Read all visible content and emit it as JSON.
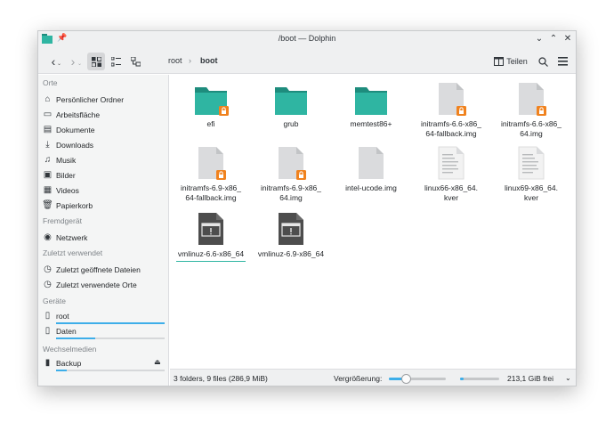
{
  "window": {
    "title": "/boot — Dolphin"
  },
  "toolbar": {
    "breadcrumb": [
      "root",
      "boot"
    ],
    "split_label": "Teilen",
    "icons": [
      "back-icon",
      "forward-icon",
      "icons-view-icon",
      "details-view-icon",
      "tree-view-icon",
      "split-icon",
      "search-icon",
      "menu-icon"
    ]
  },
  "sidebar": {
    "sections": [
      {
        "title": "Orte",
        "items": [
          {
            "label": "Persönlicher Ordner",
            "icon": "home-icon"
          },
          {
            "label": "Arbeitsfläche",
            "icon": "desktop-icon"
          },
          {
            "label": "Dokumente",
            "icon": "documents-icon"
          },
          {
            "label": "Downloads",
            "icon": "download-icon"
          },
          {
            "label": "Musik",
            "icon": "music-icon"
          },
          {
            "label": "Bilder",
            "icon": "pictures-icon"
          },
          {
            "label": "Videos",
            "icon": "video-icon"
          },
          {
            "label": "Papierkorb",
            "icon": "trash-icon"
          }
        ]
      },
      {
        "title": "Fremdgerät",
        "items": [
          {
            "label": "Netzwerk",
            "icon": "network-icon"
          }
        ]
      },
      {
        "title": "Zuletzt verwendet",
        "items": [
          {
            "label": "Zuletzt geöffnete Dateien",
            "icon": "recent-files-icon"
          },
          {
            "label": "Zuletzt verwendete Orte",
            "icon": "recent-places-icon"
          }
        ]
      },
      {
        "title": "Geräte",
        "items": [
          {
            "label": "root",
            "icon": "drive-icon",
            "usage": 1.0
          },
          {
            "label": "Daten",
            "icon": "drive-icon",
            "usage": 0.36
          }
        ]
      },
      {
        "title": "Wechselmedien",
        "items": [
          {
            "label": "Backup",
            "icon": "usb-drive-icon",
            "usage": 0.1,
            "eject": true
          }
        ]
      }
    ]
  },
  "files": [
    {
      "name": "efi",
      "type": "folder",
      "locked": true
    },
    {
      "name": "grub",
      "type": "folder",
      "locked": false
    },
    {
      "name": "memtest86+",
      "type": "folder",
      "locked": false
    },
    {
      "name": "initramfs-6.6-x86_\n64-fallback.img",
      "type": "file",
      "locked": true
    },
    {
      "name": "initramfs-6.6-x86_\n64.img",
      "type": "file",
      "locked": true
    },
    {
      "name": "initramfs-6.9-x86_\n64-fallback.img",
      "type": "file",
      "locked": true
    },
    {
      "name": "initramfs-6.9-x86_\n64.img",
      "type": "file",
      "locked": true
    },
    {
      "name": "intel-ucode.img",
      "type": "file",
      "locked": false
    },
    {
      "name": "linux66-x86_64.\nkver",
      "type": "text",
      "locked": false
    },
    {
      "name": "linux69-x86_64.\nkver",
      "type": "text",
      "locked": false
    },
    {
      "name": "vmlinuz-6.6-x86_64",
      "type": "executable",
      "locked": false,
      "underline": true
    },
    {
      "name": "vmlinuz-6.9-x86_64",
      "type": "executable",
      "locked": false
    }
  ],
  "status": {
    "summary": "3 folders, 9 files (286,9 MiB)",
    "zoom_label": "Vergrößerung:",
    "zoom_level": 0.3,
    "free_space": "213,1 GiB frei",
    "free_usage": 0.08
  },
  "colors": {
    "accent": "#3daee9",
    "folder": "#2fb5a2",
    "lock": "#f0821e"
  }
}
